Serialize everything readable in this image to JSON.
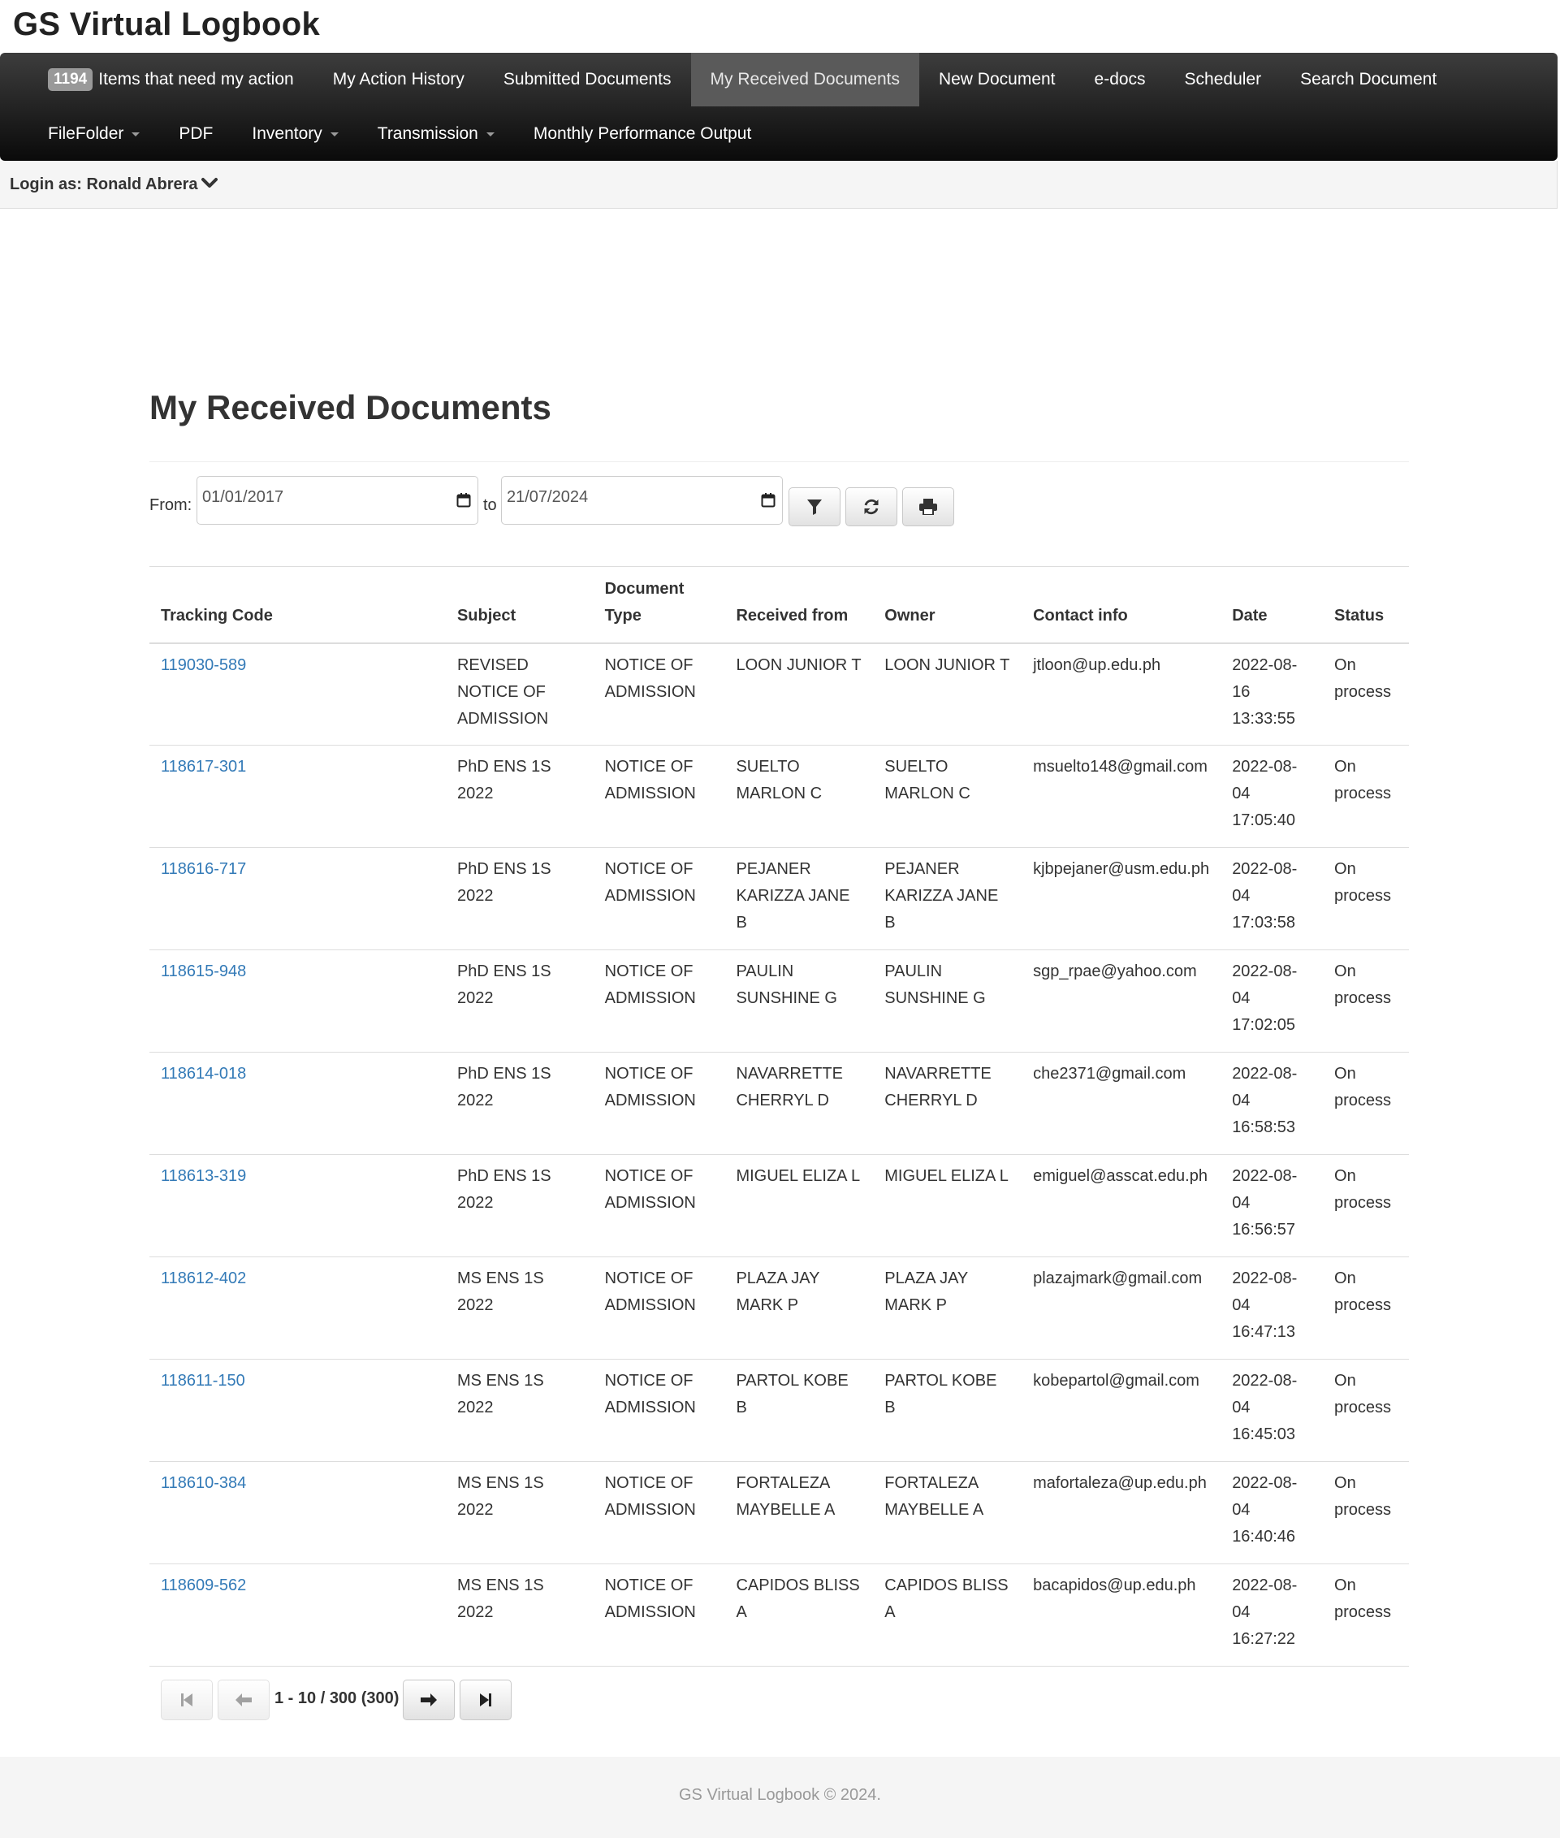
{
  "brand": "GS Virtual Logbook",
  "nav": {
    "row1": [
      {
        "badge": "1194",
        "label": "Items that need my action"
      },
      {
        "label": "My Action History"
      },
      {
        "label": "Submitted Documents"
      },
      {
        "label": "My Received Documents",
        "active": true
      },
      {
        "label": "New Document"
      },
      {
        "label": "e-docs"
      },
      {
        "label": "Scheduler"
      },
      {
        "label": "Search Document"
      }
    ],
    "row2": [
      {
        "label": "FileFolder",
        "dropdown": true
      },
      {
        "label": "PDF"
      },
      {
        "label": "Inventory",
        "dropdown": true
      },
      {
        "label": "Transmission",
        "dropdown": true
      },
      {
        "label": "Monthly Performance Output"
      }
    ]
  },
  "login": {
    "label": "Login as: Ronald Abrera",
    "icon": "chevron-down-icon"
  },
  "page_title": "My Received Documents",
  "filter": {
    "from_label": "From:",
    "from_value": "01/01/2017",
    "to_label": "to",
    "to_value": "21/07/2024",
    "buttons": [
      "filter-icon",
      "refresh-icon",
      "print-icon"
    ]
  },
  "table": {
    "headers": [
      "Tracking Code",
      "Subject",
      "Document Type",
      "Received from",
      "Owner",
      "Contact info",
      "Date",
      "Status"
    ],
    "rows": [
      {
        "code": "119030-589",
        "subject": "REVISED NOTICE OF ADMISSION",
        "type": "NOTICE OF ADMISSION",
        "from": "LOON JUNIOR T",
        "owner": "LOON JUNIOR T",
        "contact": "jtloon@up.edu.ph",
        "date": "2022-08-16 13:33:55",
        "status": "On process"
      },
      {
        "code": "118617-301",
        "subject": "PhD ENS 1S 2022",
        "type": "NOTICE OF ADMISSION",
        "from": "SUELTO MARLON C",
        "owner": "SUELTO MARLON C",
        "contact": "msuelto148@gmail.com",
        "date": "2022-08-04 17:05:40",
        "status": "On process"
      },
      {
        "code": "118616-717",
        "subject": "PhD ENS 1S 2022",
        "type": "NOTICE OF ADMISSION",
        "from": "PEJANER KARIZZA JANE B",
        "owner": "PEJANER KARIZZA JANE B",
        "contact": "kjbpejaner@usm.edu.ph",
        "date": "2022-08-04 17:03:58",
        "status": "On process"
      },
      {
        "code": "118615-948",
        "subject": "PhD ENS 1S 2022",
        "type": "NOTICE OF ADMISSION",
        "from": "PAULIN SUNSHINE G",
        "owner": "PAULIN SUNSHINE G",
        "contact": "sgp_rpae@yahoo.com",
        "date": "2022-08-04 17:02:05",
        "status": "On process"
      },
      {
        "code": "118614-018",
        "subject": "PhD ENS 1S 2022",
        "type": "NOTICE OF ADMISSION",
        "from": "NAVARRETTE CHERRYL D",
        "owner": "NAVARRETTE CHERRYL D",
        "contact": "che2371@gmail.com",
        "date": "2022-08-04 16:58:53",
        "status": "On process"
      },
      {
        "code": "118613-319",
        "subject": "PhD ENS 1S 2022",
        "type": "NOTICE OF ADMISSION",
        "from": "MIGUEL ELIZA L",
        "owner": "MIGUEL ELIZA L",
        "contact": "emiguel@asscat.edu.ph",
        "date": "2022-08-04 16:56:57",
        "status": "On process"
      },
      {
        "code": "118612-402",
        "subject": "MS ENS 1S 2022",
        "type": "NOTICE OF ADMISSION",
        "from": "PLAZA JAY MARK P",
        "owner": "PLAZA JAY MARK P",
        "contact": "plazajmark@gmail.com",
        "date": "2022-08-04 16:47:13",
        "status": "On process"
      },
      {
        "code": "118611-150",
        "subject": "MS ENS 1S 2022",
        "type": "NOTICE OF ADMISSION",
        "from": "PARTOL KOBE B",
        "owner": "PARTOL KOBE B",
        "contact": "kobepartol@gmail.com",
        "date": "2022-08-04 16:45:03",
        "status": "On process"
      },
      {
        "code": "118610-384",
        "subject": "MS ENS 1S 2022",
        "type": "NOTICE OF ADMISSION",
        "from": "FORTALEZA MAYBELLE A",
        "owner": "FORTALEZA MAYBELLE A",
        "contact": "mafortaleza@up.edu.ph",
        "date": "2022-08-04 16:40:46",
        "status": "On process"
      },
      {
        "code": "118609-562",
        "subject": "MS ENS 1S 2022",
        "type": "NOTICE OF ADMISSION",
        "from": "CAPIDOS BLISS A",
        "owner": "CAPIDOS BLISS A",
        "contact": "bacapidos@up.edu.ph",
        "date": "2022-08-04 16:27:22",
        "status": "On process"
      }
    ]
  },
  "pagination": {
    "info": "1 - 10 / 300 (300)",
    "buttons": [
      "first-page-icon",
      "prev-page-icon",
      "next-page-icon",
      "last-page-icon"
    ]
  },
  "footer": "GS Virtual Logbook © 2024.",
  "colors": {
    "link": "#337ab7",
    "navbar": "#1a1a1a",
    "nav_active": "#5a5a5a",
    "badge": "#999999"
  }
}
